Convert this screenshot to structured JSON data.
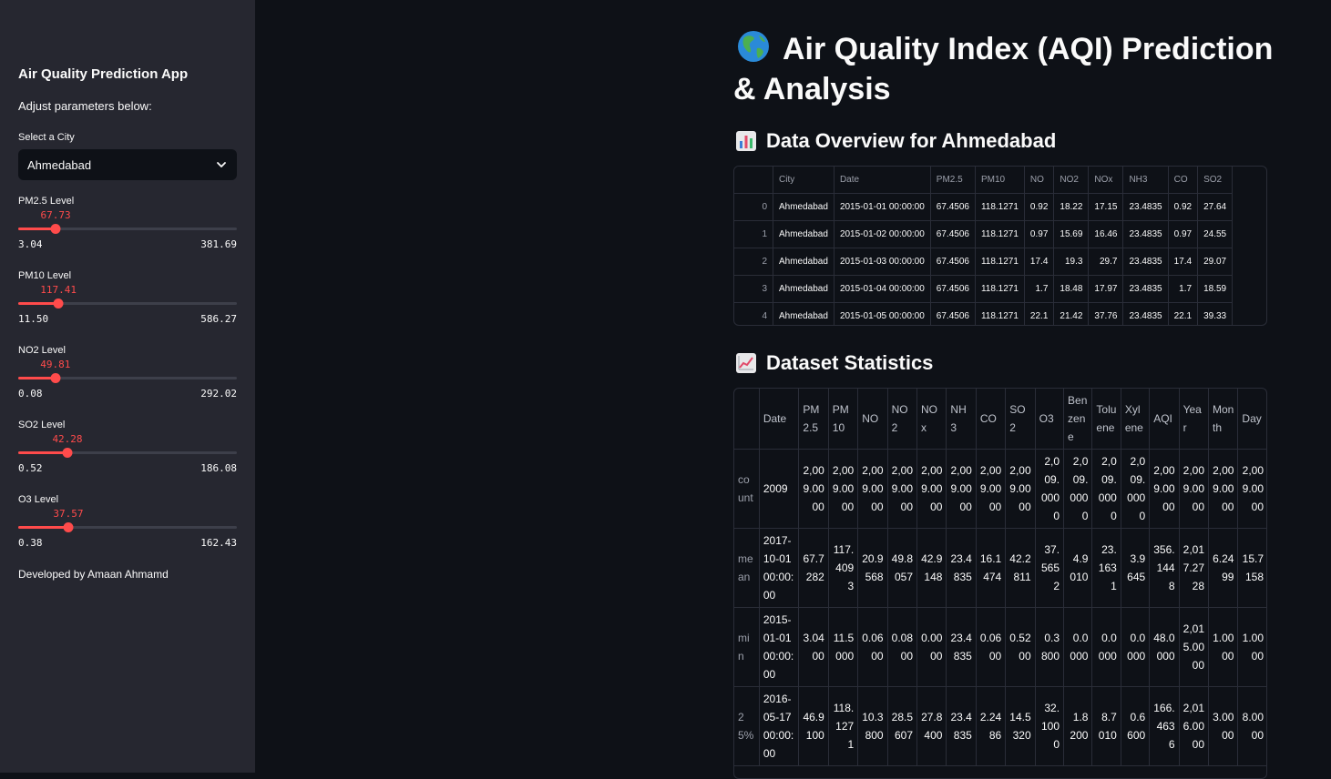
{
  "sidebar": {
    "title": "Air Quality Prediction App",
    "subtitle": "Adjust parameters below:",
    "city_label": "Select a City",
    "city_value": "Ahmedabad",
    "sliders": [
      {
        "label": "PM2.5 Level",
        "value": "67.73",
        "min": "3.04",
        "max": "381.69",
        "fraction": 0.171
      },
      {
        "label": "PM10 Level",
        "value": "117.41",
        "min": "11.50",
        "max": "586.27",
        "fraction": 0.184
      },
      {
        "label": "NO2 Level",
        "value": "49.81",
        "min": "0.08",
        "max": "292.02",
        "fraction": 0.17
      },
      {
        "label": "SO2 Level",
        "value": "42.28",
        "min": "0.52",
        "max": "186.08",
        "fraction": 0.225
      },
      {
        "label": "O3 Level",
        "value": "37.57",
        "min": "0.38",
        "max": "162.43",
        "fraction": 0.229
      }
    ],
    "footer": "Developed by Amaan Ahmamd"
  },
  "main": {
    "title": "Air Quality Index (AQI) Prediction & Analysis",
    "overview_heading": "Data Overview for Ahmedabad",
    "stats_heading": "Dataset Statistics"
  },
  "overview_table": {
    "columns": [
      "",
      "City",
      "Date",
      "PM2.5",
      "PM10",
      "NO",
      "NO2",
      "NOx",
      "NH3",
      "CO",
      "SO2"
    ],
    "rows": [
      [
        "0",
        "Ahmedabad",
        "2015-01-01 00:00:00",
        "67.4506",
        "118.1271",
        "0.92",
        "18.22",
        "17.15",
        "23.4835",
        "0.92",
        "27.64"
      ],
      [
        "1",
        "Ahmedabad",
        "2015-01-02 00:00:00",
        "67.4506",
        "118.1271",
        "0.97",
        "15.69",
        "16.46",
        "23.4835",
        "0.97",
        "24.55"
      ],
      [
        "2",
        "Ahmedabad",
        "2015-01-03 00:00:00",
        "67.4506",
        "118.1271",
        "17.4",
        "19.3",
        "29.7",
        "23.4835",
        "17.4",
        "29.07"
      ],
      [
        "3",
        "Ahmedabad",
        "2015-01-04 00:00:00",
        "67.4506",
        "118.1271",
        "1.7",
        "18.48",
        "17.97",
        "23.4835",
        "1.7",
        "18.59"
      ],
      [
        "4",
        "Ahmedabad",
        "2015-01-05 00:00:00",
        "67.4506",
        "118.1271",
        "22.1",
        "21.42",
        "37.76",
        "23.4835",
        "22.1",
        "39.33"
      ]
    ]
  },
  "stats_table": {
    "columns": [
      "",
      "Date",
      "PM2.5",
      "PM10",
      "NO",
      "NO2",
      "NOx",
      "NH3",
      "CO",
      "SO2",
      "O3",
      "Benzene",
      "Toluene",
      "Xylene",
      "AQI",
      "Year",
      "Month",
      "Day"
    ],
    "rows": [
      [
        "count",
        "2009",
        "2,009.0000",
        "2,009.0000",
        "2,009.0000",
        "2,009.0000",
        "2,009.0000",
        "2,009.0000",
        "2,009.0000",
        "2,009.0000",
        "2,009.0000",
        "2,009.0000",
        "2,009.0000",
        "2,009.0000",
        "2,009.0000",
        "2,009.0000",
        "2,009.0000",
        "2,009.0000"
      ],
      [
        "mean",
        "2017-10-01 00:00:00",
        "67.7282",
        "117.4093",
        "20.9568",
        "49.8057",
        "42.9148",
        "23.4835",
        "16.1474",
        "42.2811",
        "37.5652",
        "4.9010",
        "23.1631",
        "3.9645",
        "356.1448",
        "2,017.2728",
        "6.2499",
        "15.7158"
      ],
      [
        "min",
        "2015-01-01 00:00:00",
        "3.0400",
        "11.5000",
        "0.0600",
        "0.0800",
        "0.0000",
        "23.4835",
        "0.0600",
        "0.5200",
        "0.3800",
        "0.0000",
        "0.0000",
        "0.0000",
        "48.0000",
        "2,015.0000",
        "1.0000",
        "1.0000"
      ],
      [
        "25%",
        "2016-05-17 00:00:00",
        "46.9100",
        "118.1271",
        "10.3800",
        "28.5607",
        "27.8400",
        "23.4835",
        "2.2486",
        "14.5320",
        "32.1000",
        "1.8200",
        "8.7010",
        "0.6600",
        "166.4636",
        "2,016.0000",
        "3.0000",
        "8.0000"
      ]
    ]
  },
  "colors": {
    "accent": "#ff4b4b",
    "sidebar_bg": "#262730",
    "main_bg": "#0e1117"
  },
  "icons": {
    "title": "globe-americas-icon",
    "overview": "bar-chart-icon",
    "stats": "chart-increasing-icon",
    "select": "chevron-down-icon"
  }
}
